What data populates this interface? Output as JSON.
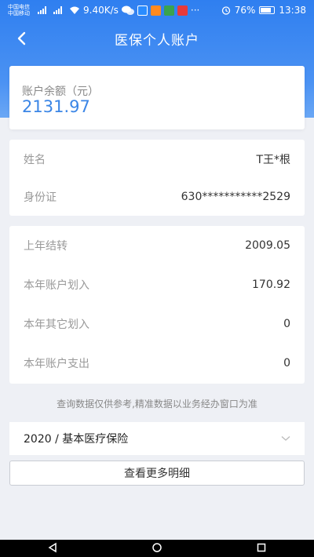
{
  "status_bar": {
    "carrier_1": "中国电信",
    "carrier_2": "中国移动",
    "net_speed": "9.40K/s",
    "battery": "76%",
    "time": "13:38"
  },
  "header": {
    "title": "医保个人账户"
  },
  "balance": {
    "label": "账户余额（元）",
    "value": "2131.97"
  },
  "info": {
    "rows": [
      {
        "label": "姓名",
        "value": "T王*根"
      },
      {
        "label": "身份证",
        "value": "630***********2529"
      }
    ]
  },
  "stats": {
    "rows": [
      {
        "label": "上年结转",
        "value": "2009.05"
      },
      {
        "label": "本年账户划入",
        "value": "170.92"
      },
      {
        "label": "本年其它划入",
        "value": "0"
      },
      {
        "label": "本年账户支出",
        "value": "0"
      }
    ]
  },
  "notice": "查询数据仅供参考,精准数据以业务经办窗口为准",
  "insurance_select": {
    "value": "2020 / 基本医疗保险"
  },
  "more_button": {
    "label": "查看更多明细"
  },
  "colors": {
    "header_blue": "#2f7ff0",
    "balance_blue": "#3b86e6",
    "background": "#eef0f5"
  }
}
